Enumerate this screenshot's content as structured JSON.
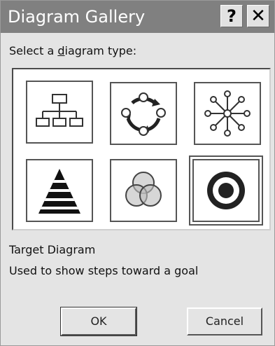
{
  "window": {
    "title": "Diagram Gallery",
    "help_label": "?",
    "close_label": "✕"
  },
  "prompt": {
    "before": "Select a ",
    "mnemonic": "d",
    "after": "iagram type:"
  },
  "gallery": {
    "items": [
      {
        "name": "Organization Chart",
        "icon": "org-chart-icon"
      },
      {
        "name": "Cycle Diagram",
        "icon": "cycle-icon"
      },
      {
        "name": "Radial Diagram",
        "icon": "radial-icon"
      },
      {
        "name": "Pyramid Diagram",
        "icon": "pyramid-icon"
      },
      {
        "name": "Venn Diagram",
        "icon": "venn-icon"
      },
      {
        "name": "Target Diagram",
        "icon": "target-icon"
      }
    ],
    "selected": "Target Diagram"
  },
  "description": {
    "title": "Target Diagram",
    "text": "Used to show steps toward a goal"
  },
  "buttons": {
    "ok": "OK",
    "cancel": "Cancel"
  },
  "colors": {
    "titlebar": "#808080",
    "dialog_bg": "#e4e4e4",
    "gallery_bg": "#ffffff"
  }
}
